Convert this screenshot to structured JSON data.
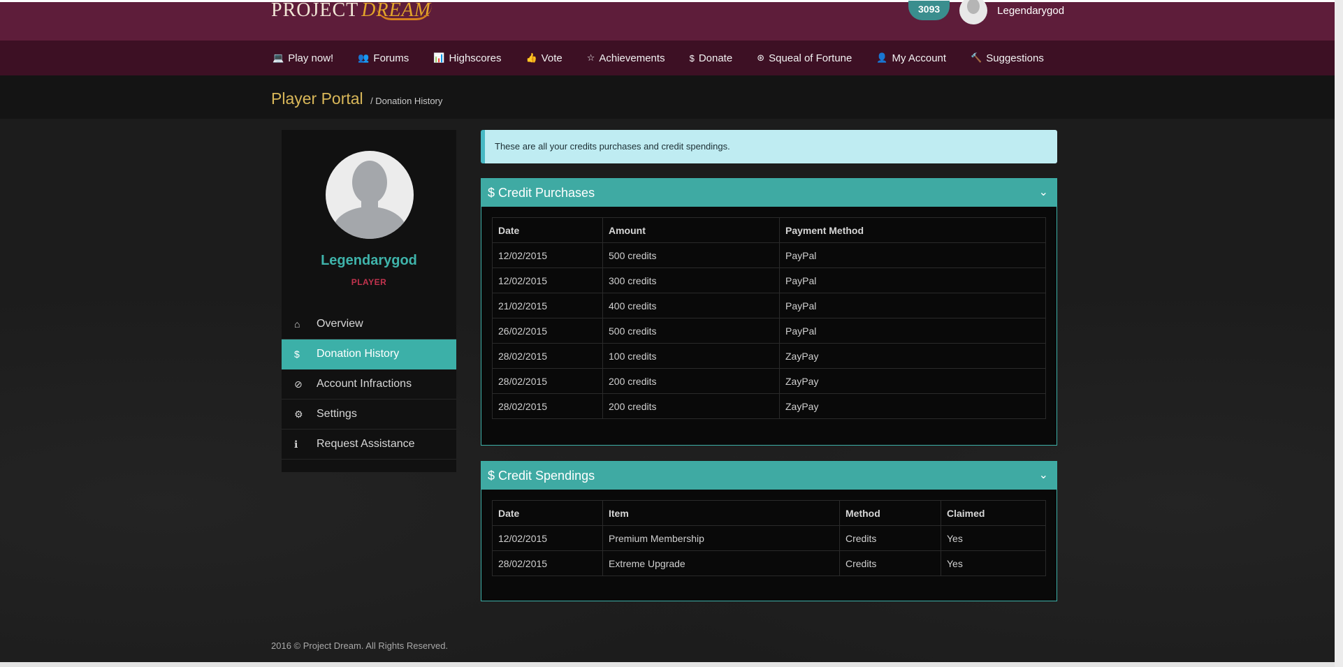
{
  "brand": {
    "logo_text_a": "PROJECT",
    "logo_text_b": "DREAM"
  },
  "header": {
    "credits": "3093",
    "username": "Legendarygod"
  },
  "nav": {
    "items": [
      {
        "label": "Play now!",
        "icon": "laptop-icon",
        "glyph": "💻"
      },
      {
        "label": "Forums",
        "icon": "users-icon",
        "glyph": "👥"
      },
      {
        "label": "Highscores",
        "icon": "bar-chart-icon",
        "glyph": "📊"
      },
      {
        "label": "Vote",
        "icon": "thumbs-up-icon",
        "glyph": "👍"
      },
      {
        "label": "Achievements",
        "icon": "star-icon",
        "glyph": "☆"
      },
      {
        "label": "Donate",
        "icon": "dollar-icon",
        "glyph": "$"
      },
      {
        "label": "Squeal of Fortune",
        "icon": "wheel-icon",
        "glyph": "⊛"
      },
      {
        "label": "My Account",
        "icon": "user-icon",
        "glyph": "👤"
      },
      {
        "label": "Suggestions",
        "icon": "gavel-icon",
        "glyph": "🔨"
      }
    ]
  },
  "title_bar": {
    "title": "Player Portal",
    "breadcrumb": "/ Donation History"
  },
  "sidebar": {
    "name": "Legendarygod",
    "role": "PLAYER",
    "items": [
      {
        "label": "Overview",
        "icon": "home-icon",
        "glyph": "⌂"
      },
      {
        "label": "Donation History",
        "icon": "dollar-icon",
        "glyph": "$",
        "active": true
      },
      {
        "label": "Account Infractions",
        "icon": "ban-icon",
        "glyph": "⊘"
      },
      {
        "label": "Settings",
        "icon": "gear-icon",
        "glyph": "⚙"
      },
      {
        "label": "Request Assistance",
        "icon": "info-icon",
        "glyph": "ℹ"
      }
    ]
  },
  "alert": {
    "text": "These are all your credits purchases and credit spendings."
  },
  "purchases": {
    "title": "$ Credit Purchases",
    "columns": [
      "Date",
      "Amount",
      "Payment Method"
    ],
    "rows": [
      [
        "12/02/2015",
        "500 credits",
        "PayPal"
      ],
      [
        "12/02/2015",
        "300 credits",
        "PayPal"
      ],
      [
        "21/02/2015",
        "400 credits",
        "PayPal"
      ],
      [
        "26/02/2015",
        "500 credits",
        "PayPal"
      ],
      [
        "28/02/2015",
        "100 credits",
        "ZayPay"
      ],
      [
        "28/02/2015",
        "200 credits",
        "ZayPay"
      ],
      [
        "28/02/2015",
        "200 credits",
        "ZayPay"
      ]
    ]
  },
  "spendings": {
    "title": "$ Credit Spendings",
    "columns": [
      "Date",
      "Item",
      "Method",
      "Claimed"
    ],
    "rows": [
      [
        "12/02/2015",
        "Premium Membership",
        "Credits",
        "Yes"
      ],
      [
        "28/02/2015",
        "Extreme Upgrade",
        "Credits",
        "Yes"
      ]
    ]
  },
  "footer": {
    "text": "2016 © Project Dream. All Rights Reserved."
  },
  "colors": {
    "header": "#5e1d3a",
    "nav": "#3d1024",
    "accent": "#3faaa3",
    "title_gold": "#d9b759",
    "role_red": "#c2334e"
  }
}
